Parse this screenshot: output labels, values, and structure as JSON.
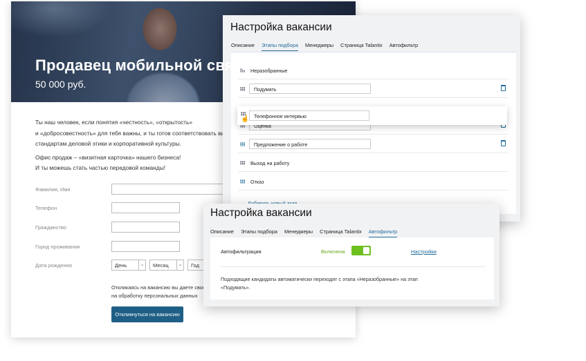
{
  "vacancy": {
    "title": "Продавец мобильной связи",
    "salary": "50 000 руб.",
    "description": [
      "Ты наш человек, если понятия «честность», «открытость»",
      "и «добросовестность» для тебя важны, и ты готов соответствовать высоким",
      "стандартам деловой этики и корпоративной культуры."
    ],
    "description2": [
      "Офис продаж – «визитная карточка» нашего бизнеса!",
      "И ты можешь стать частью передовой команды!"
    ],
    "form": {
      "name_label": "Фамилия, Имя",
      "phone_label": "Телефон",
      "citizenship_label": "Гражданство",
      "city_label": "Город проживания",
      "birthdate_label": "Дата рождения",
      "day": "День",
      "month": "Месяц",
      "year": "Год"
    },
    "consent": [
      "Откликаясь на вакансию вы даете свое",
      "на обработку персональных данных"
    ],
    "apply_button": "Откликнуться на вакансию"
  },
  "settings": {
    "title": "Настройка вакансии",
    "tabs": [
      "Описание",
      "Этапы подбора",
      "Менеджеры",
      "Страница Talantix",
      "Автофильтр"
    ],
    "active_tab": "Этапы подбора",
    "stages": [
      {
        "name": "Неразобранные",
        "editable": false
      },
      {
        "name": "Подумать",
        "editable": true
      },
      {
        "name": "Оценка",
        "editable": true
      },
      {
        "name": "Предложение о работе",
        "editable": true
      },
      {
        "name": "Выход на работу",
        "editable": false
      },
      {
        "name": "Отказ",
        "editable": false
      }
    ],
    "dragging_stage": "Телефонное интервью",
    "add_stage": "Добавить новый этап"
  },
  "autofilter": {
    "title": "Настройка вакансии",
    "tabs": [
      "Описание",
      "Этапы подбора",
      "Менеджеры",
      "Страница Talantix",
      "Автофильтр"
    ],
    "active_tab": "Автофильтр",
    "label": "Автофильтрация",
    "state": "Включена",
    "enabled": true,
    "settings_link": "Настройки",
    "note": "Подходящие кандидаты автоматически переходят с этапа «Неразобранные» на этап «Подумать».",
    "colors": {
      "toggle": "#6ec01f",
      "accent": "#1f6a9a"
    }
  }
}
